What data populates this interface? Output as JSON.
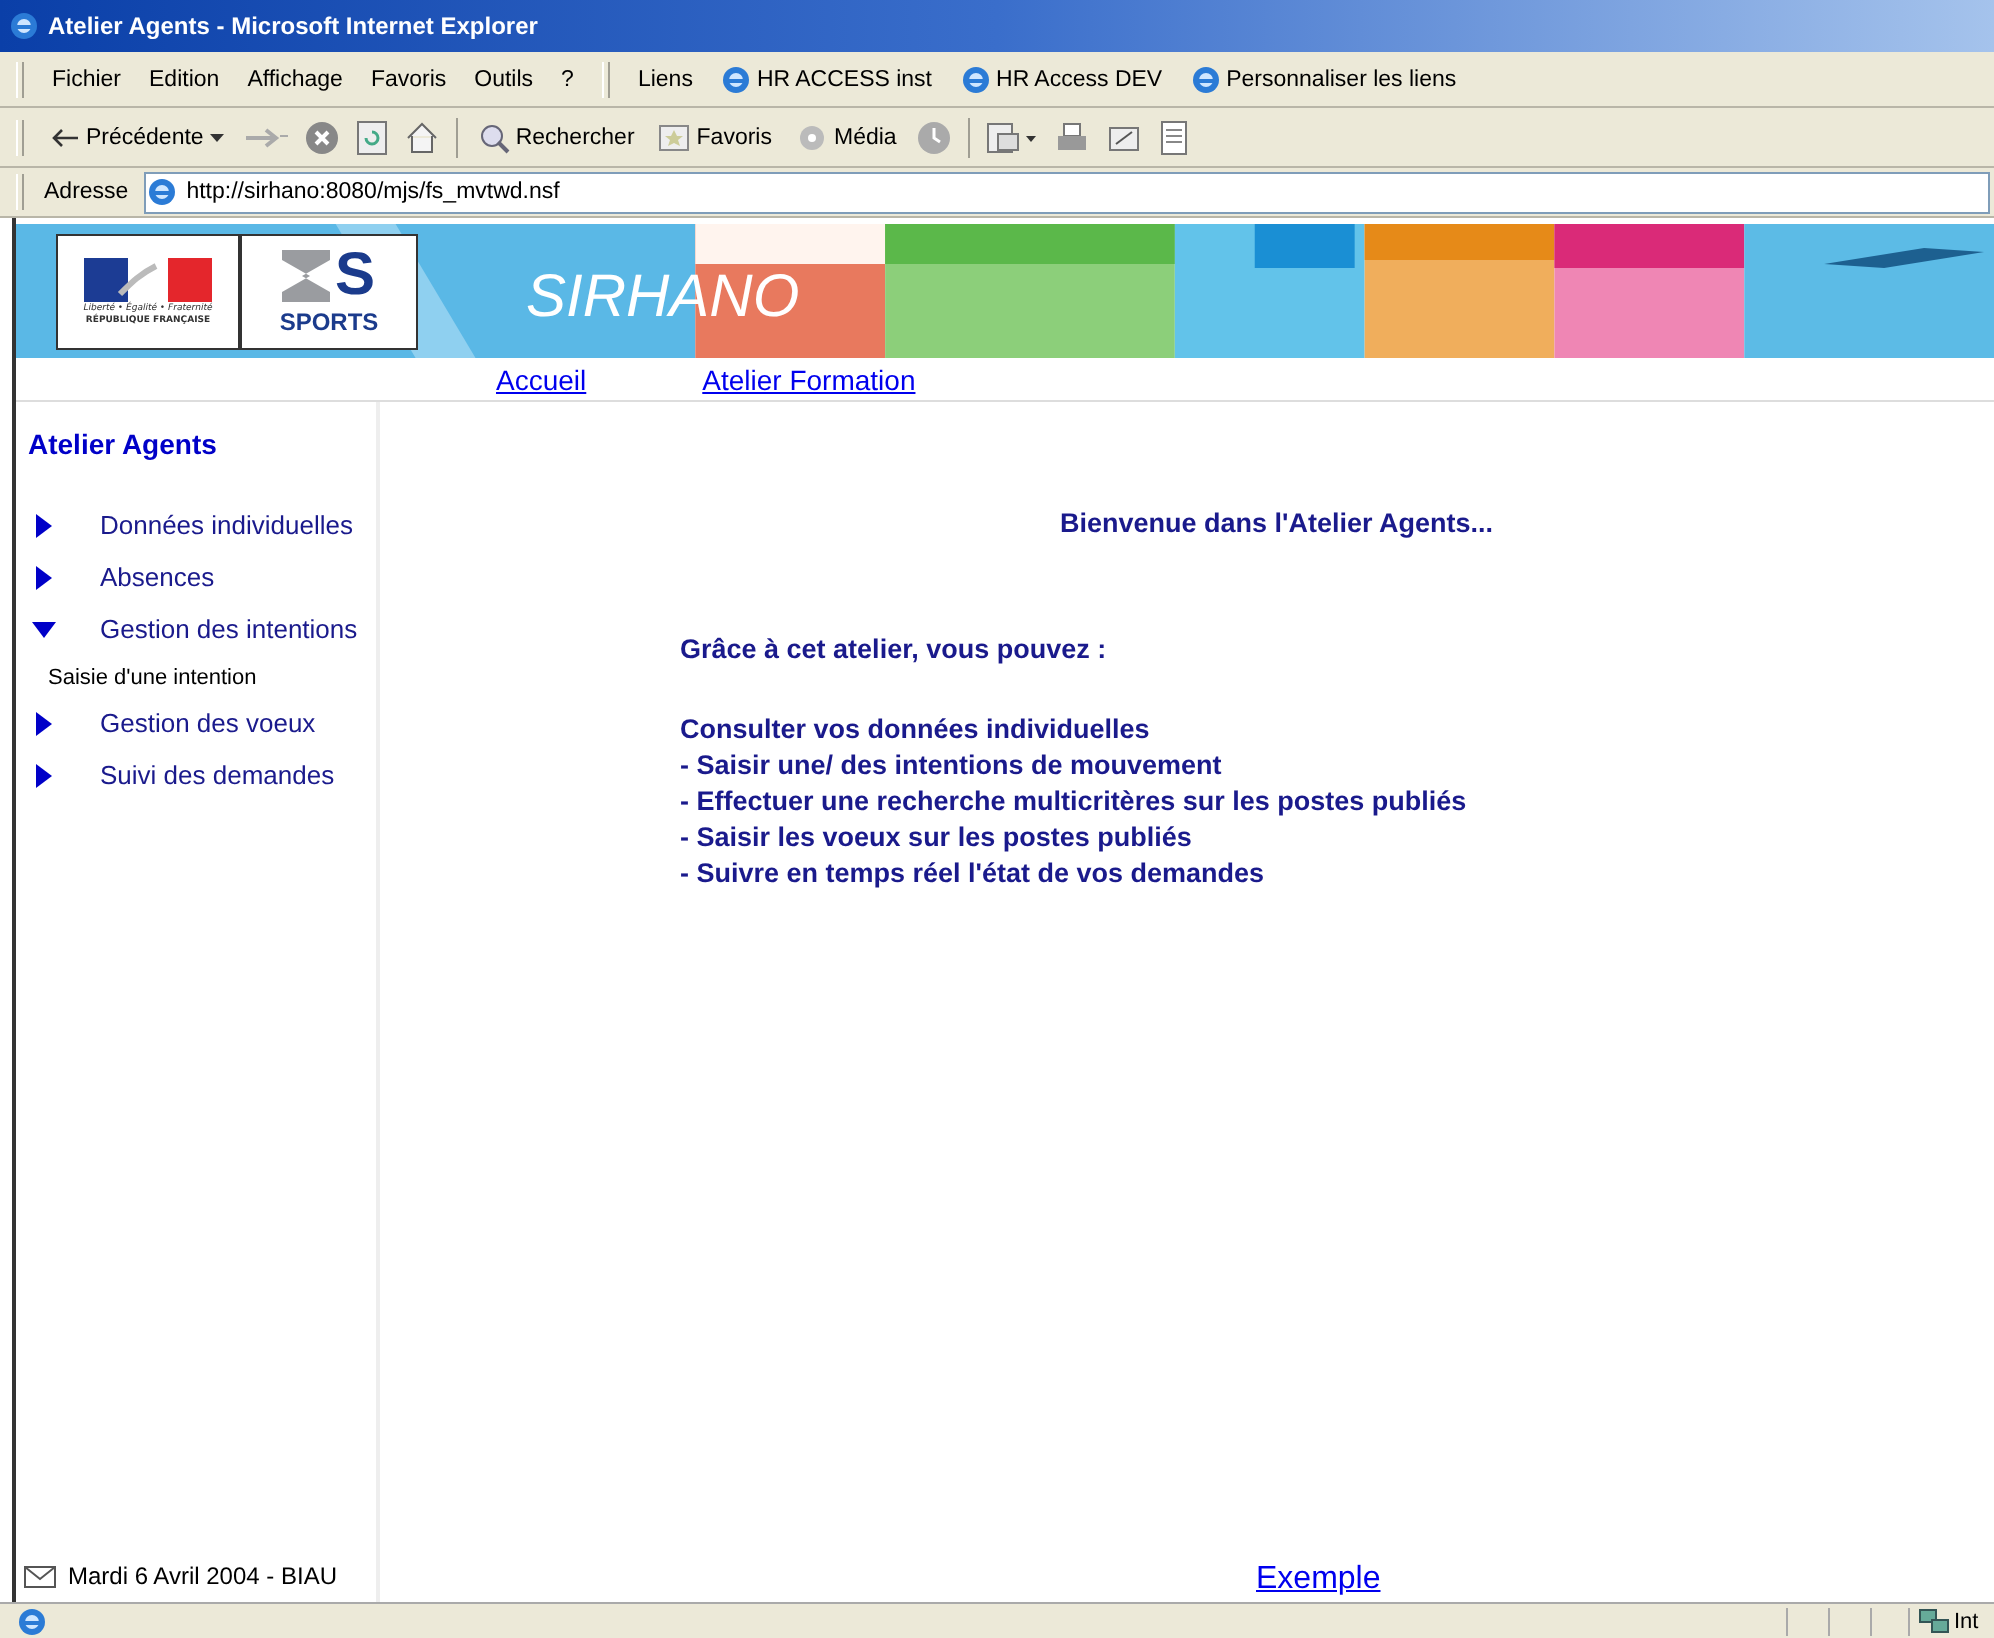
{
  "window": {
    "title": "Atelier Agents - Microsoft Internet Explorer"
  },
  "menu_bar": {
    "menus": [
      "Fichier",
      "Edition",
      "Affichage",
      "Favoris",
      "Outils",
      "?"
    ],
    "links_label": "Liens",
    "links": [
      "HR ACCESS inst",
      "HR Access DEV",
      "Personnaliser les liens"
    ]
  },
  "toolbar": {
    "back": "Précédente",
    "search": "Rechercher",
    "favorites": "Favoris",
    "media": "Média"
  },
  "address_bar": {
    "label": "Adresse",
    "value": "http://sirhano:8080/mjs/fs_mvtwd.nsf"
  },
  "banner": {
    "republic_motto": "Liberté • Égalité • Fraternité",
    "republic_name": "RÉPUBLIQUE FRANÇAISE",
    "ministry_logo": "S",
    "ministry_name": "SPORTS",
    "app_name": "SIRHANO"
  },
  "top_nav": [
    "Accueil",
    "Atelier Formation"
  ],
  "sidebar": {
    "title": "Atelier Agents",
    "items": [
      {
        "label": "Données individuelles",
        "expanded": false
      },
      {
        "label": "Absences",
        "expanded": false
      },
      {
        "label": "Gestion des intentions",
        "expanded": true,
        "children": [
          {
            "label": "Saisie d'une intention"
          }
        ]
      },
      {
        "label": "Gestion des voeux",
        "expanded": false
      },
      {
        "label": "Suivi des demandes",
        "expanded": false
      }
    ]
  },
  "main": {
    "welcome": "Bienvenue dans l'Atelier Agents...",
    "intro": "Grâce à cet atelier, vous pouvez :",
    "lines": [
      "Consulter vos données individuelles",
      "- Saisir une/ des intentions de mouvement",
      "- Effectuer une recherche multicritères sur les postes publiés",
      "- Saisir les voeux sur les postes publiés",
      "- Suivre en temps réel l'état de vos demandes"
    ]
  },
  "footer": {
    "date": "Mardi 6 Avril 2004 - BIAU",
    "link": "Exemple"
  },
  "status_bar": {
    "zone": "Int"
  }
}
